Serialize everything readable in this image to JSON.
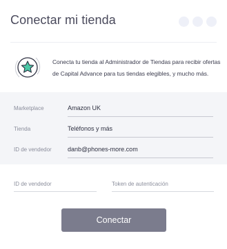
{
  "header": {
    "title": "Conectar mi tienda",
    "dot_count": 3
  },
  "info": {
    "icon": "star-icon",
    "text": "Conecta tu tienda al Administrador de Tiendas para recibir ofertas de Capital Advance para tus tiendas elegibles, y mucho más.",
    "accent_color": "#4cc9a7"
  },
  "store_form": {
    "marketplace": {
      "label": "Marketplace",
      "value": "Amazon UK"
    },
    "store": {
      "label": "Tienda",
      "value": "Teléfonos y más"
    },
    "seller_id": {
      "label": "ID de vendedor",
      "value": "danb@phones-more.com"
    }
  },
  "credentials": {
    "seller_id": {
      "label": "ID de vendedor"
    },
    "auth_token": {
      "label": "Token de autenticación"
    }
  },
  "actions": {
    "connect_label": "Conectar",
    "connect_color": "#7b7c8d"
  }
}
